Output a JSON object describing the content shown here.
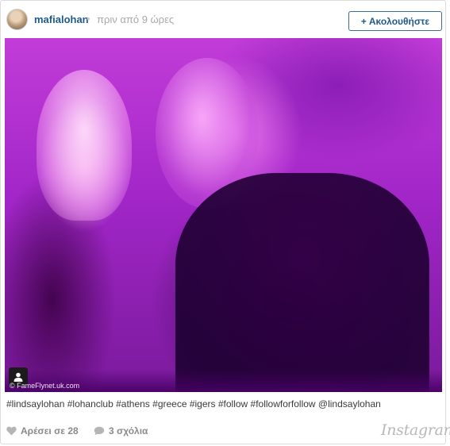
{
  "header": {
    "username": "mafialohan",
    "separator": "•",
    "timestamp": "πριν από 9 ώρες",
    "follow_plus": "+",
    "follow_label": "Ακολουθήστε"
  },
  "photo": {
    "watermark": "© FameFlynet.uk.com",
    "user_tag_icon": "person-icon"
  },
  "caption": "#lindsaylohan #lohanclub #athens #greece #igers #follow #followforfollow @lindsaylohan",
  "footer": {
    "likes_label": "Αρέσει σε 28",
    "comments_label": "3 σχόλια",
    "brand": "Instagram",
    "icons": [
      "heart-icon",
      "comment-bubble-icon"
    ]
  },
  "colors": {
    "link": "#1e5a8c",
    "muted": "#a8a8a8",
    "photo_tint": "#b030d0"
  }
}
